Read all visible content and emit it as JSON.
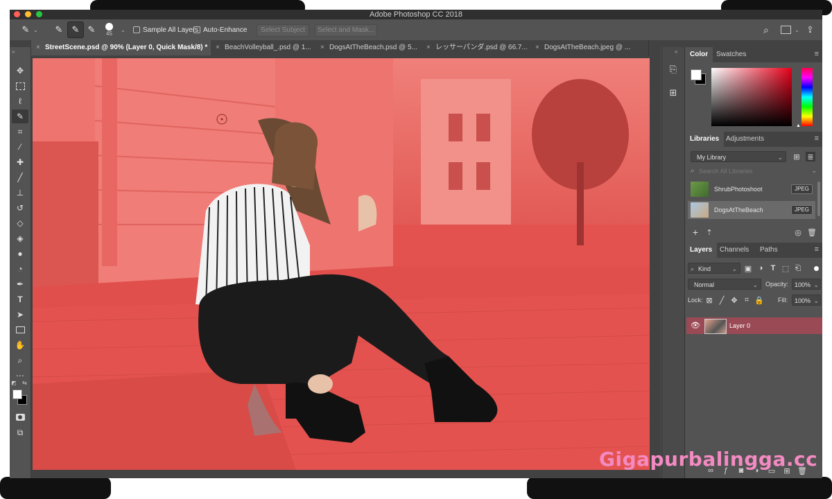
{
  "window": {
    "title": "Adobe Photoshop CC 2018"
  },
  "options_bar": {
    "brush_size": "45",
    "sample_all_layers": "Sample All Layers",
    "auto_enhance": "Auto-Enhance",
    "select_subject": "Select Subject",
    "select_and_mask": "Select and Mask..."
  },
  "tabs": [
    {
      "label": "StreetScene.psd @ 90% (Layer 0, Quick Mask/8) *",
      "active": true
    },
    {
      "label": "BeachVolleyball_.psd @ 1...",
      "active": false
    },
    {
      "label": "DogsAtTheBeach.psd @ 5...",
      "active": false
    },
    {
      "label": "レッサーパンダ.psd @ 66.7...",
      "active": false
    },
    {
      "label": "DogsAtTheBeach.jpeg @ ...",
      "active": false
    }
  ],
  "color_panel": {
    "tab_color": "Color",
    "tab_swatches": "Swatches"
  },
  "libraries_panel": {
    "tab_libraries": "Libraries",
    "tab_adjustments": "Adjustments",
    "library_select": "My Library",
    "search_placeholder": "Search All Libraries",
    "items": [
      {
        "name": "ShrubPhotoshoot",
        "badge": "JPEG"
      },
      {
        "name": "DogsAtTheBeach",
        "badge": "JPEG"
      }
    ]
  },
  "layers_panel": {
    "tab_layers": "Layers",
    "tab_channels": "Channels",
    "tab_paths": "Paths",
    "filter_kind": "Kind",
    "blend_mode": "Normal",
    "opacity_label": "Opacity:",
    "opacity_value": "100%",
    "lock_label": "Lock:",
    "fill_label": "Fill:",
    "fill_value": "100%",
    "layer_name": "Layer 0"
  },
  "watermark": "Gigapurbalingga.cc",
  "colors": {
    "quick_mask": "#e4524f",
    "panel_bg": "#535353",
    "dark_bg": "#424242",
    "layer_selected": "#9a4a55",
    "watermark": "#f38ac1"
  }
}
